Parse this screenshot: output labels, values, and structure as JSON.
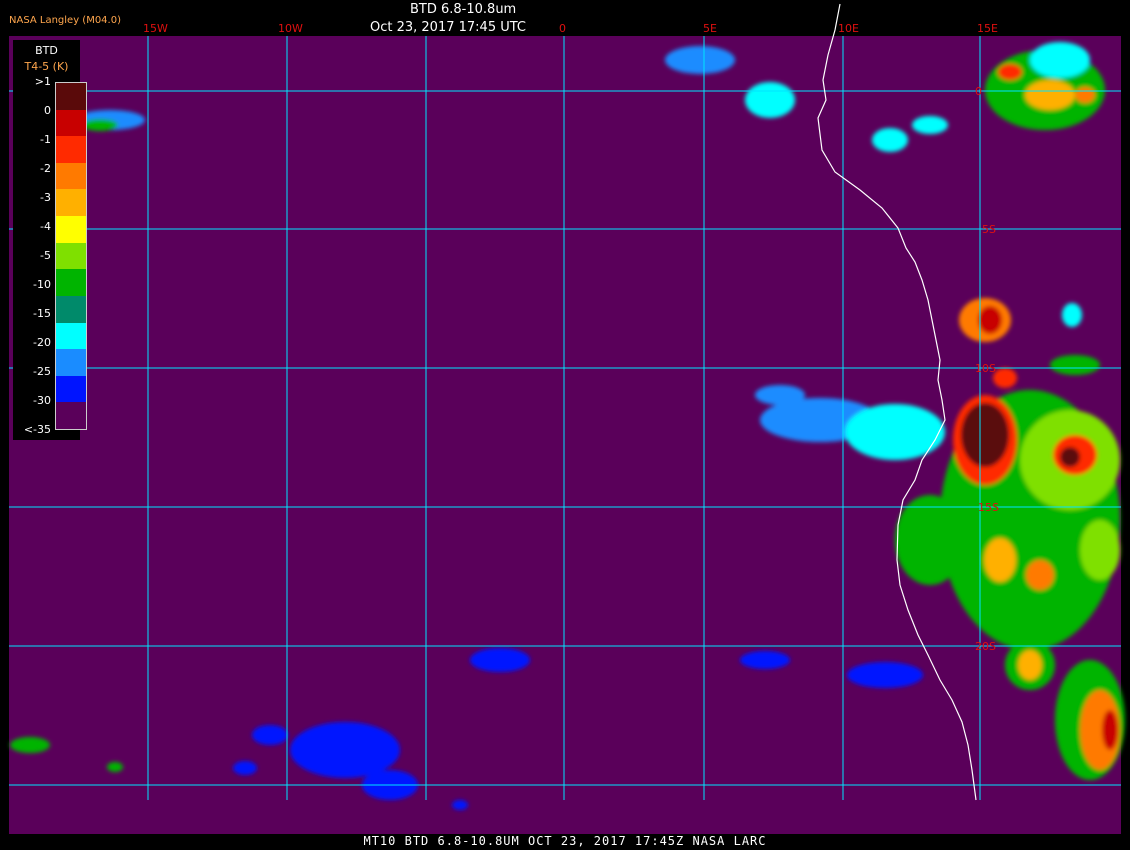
{
  "header": {
    "title": "BTD 6.8-10.8um",
    "datetime": "Oct 23, 2017 17:45 UTC",
    "credit": "NASA Langley (M04.0)"
  },
  "footer": "MT10  BTD 6.8-10.8UM  OCT 23, 2017 17:45Z  NASA LARC",
  "legend": {
    "title": "BTD",
    "subtitle": "T4-5 (K)",
    "ticks": [
      ">1",
      "0",
      "-1",
      "-2",
      "-3",
      "-4",
      "-5",
      "-10",
      "-15",
      "-20",
      "-25",
      "-30",
      "<-35"
    ],
    "colors": [
      "#5a0a0a",
      "#c80000",
      "#ff2a00",
      "#ff7a00",
      "#ffb000",
      "#ffff00",
      "#7fe000",
      "#00b400",
      "#008a6a",
      "#00ffff",
      "#1a8cff",
      "#0014ff",
      "#5a005a"
    ]
  },
  "graticule": {
    "lon_labels": [
      "15W",
      "10W",
      "0",
      "5E",
      "10E",
      "15E"
    ],
    "lat_labels": [
      "0",
      "5S",
      "10S",
      "15S",
      "20S"
    ]
  },
  "colors": {
    "background": "#5a005a",
    "grid": "#00e5ff",
    "coast": "#ffffff",
    "grid_label": "#e01010"
  }
}
